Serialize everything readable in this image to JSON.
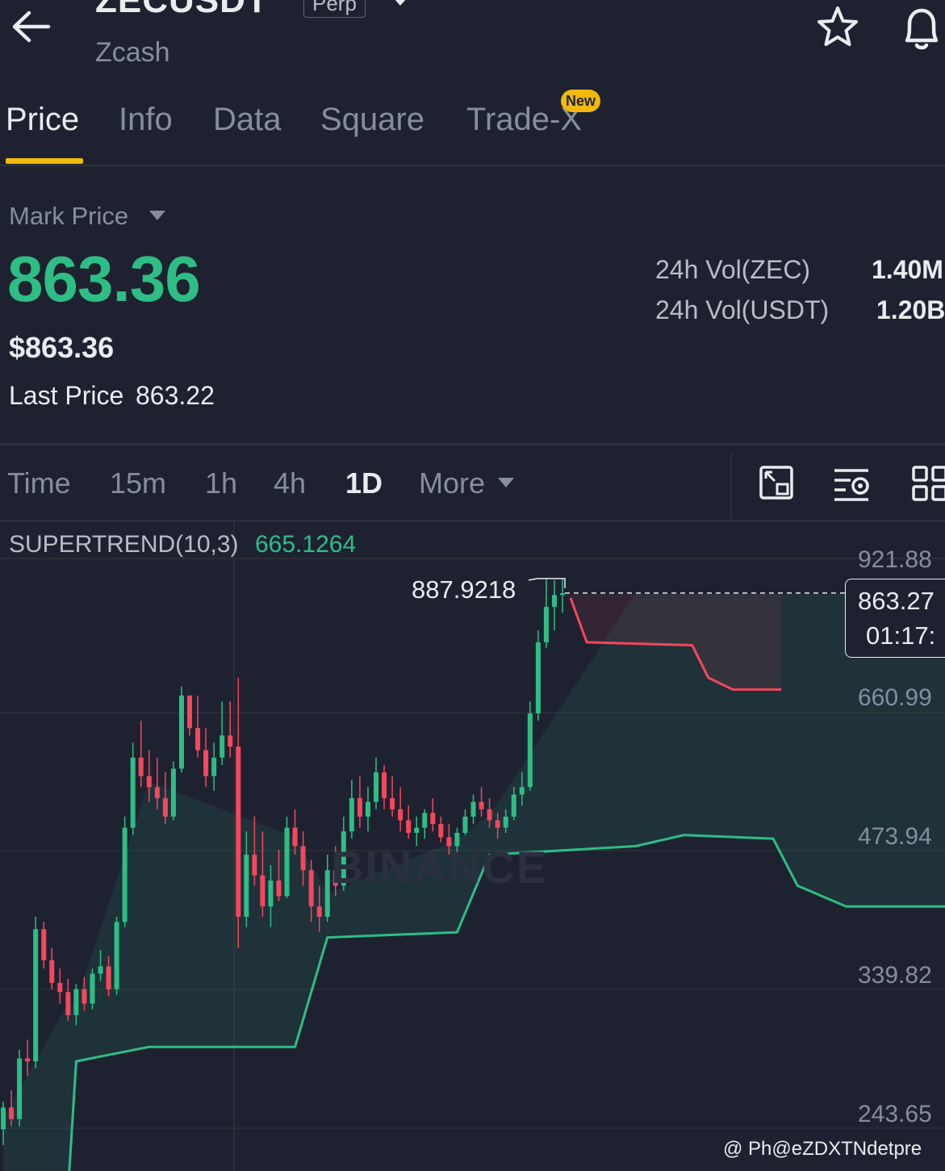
{
  "header": {
    "symbol": "ZECUSDT",
    "contract_badge": "Perp",
    "coin_name": "Zcash",
    "icons": [
      "back-arrow-icon",
      "chevron-down-icon",
      "star-icon",
      "bell-icon"
    ]
  },
  "tabs": [
    {
      "label": "Price",
      "active": true
    },
    {
      "label": "Info"
    },
    {
      "label": "Data"
    },
    {
      "label": "Square"
    },
    {
      "label": "Trade-X",
      "badge": "New"
    }
  ],
  "price_block": {
    "mark_price_label": "Mark Price",
    "mark_price": "863.36",
    "usd_price": "$863.36",
    "last_price_label": "Last Price",
    "last_price": "863.22",
    "stats": [
      {
        "label": "24h Vol(ZEC)",
        "value": "1.40M"
      },
      {
        "label": "24h Vol(USDT)",
        "value": "1.20B"
      }
    ]
  },
  "intervals": {
    "items": [
      "Time",
      "15m",
      "1h",
      "4h",
      "1D",
      "More"
    ],
    "active": "1D",
    "tool_icons": [
      "fullscreen-icon",
      "indicator-settings-icon",
      "grid-layout-icon"
    ]
  },
  "chart": {
    "indicator_label": "SUPERTREND(10,3)",
    "indicator_value": "665.1264",
    "axis_labels": [
      "921.88",
      "660.99",
      "473.94",
      "339.82",
      "243.65"
    ],
    "high_label": "887.9218",
    "current_price_tag": "863.27",
    "countdown": "01:17:",
    "watermark": "BINANCE",
    "credit": "@ Ph@eZDXTNdetpre"
  },
  "colors": {
    "background": "#1e2230",
    "up": "#2ebd85",
    "down": "#f6465d",
    "accent": "#f0b90b",
    "muted_text": "#848e9c"
  },
  "chart_data": {
    "type": "candlestick",
    "title": "",
    "indicator": "SUPERTREND(10,3)",
    "y_ticks": [
      921.88,
      660.99,
      473.94,
      339.82,
      243.65
    ],
    "highest_marked": 887.9218,
    "last_price": 863.27,
    "supertrend_value": 665.1264,
    "supertrend_segments": [
      {
        "trend": "up",
        "points": [
          [
            0,
            200
          ],
          [
            8,
            200
          ],
          [
            9,
            290
          ],
          [
            18,
            300
          ],
          [
            36,
            300
          ],
          [
            40,
            390
          ],
          [
            56,
            395
          ],
          [
            60,
            470
          ],
          [
            78,
            480
          ],
          [
            84,
            495
          ],
          [
            95,
            490
          ],
          [
            98,
            440
          ],
          [
            104,
            420
          ],
          [
            120,
            420
          ],
          [
            130,
            380
          ]
        ]
      },
      {
        "trend": "down",
        "points": [
          [
            70,
            855
          ],
          [
            72,
            780
          ],
          [
            85,
            775
          ],
          [
            87,
            720
          ],
          [
            90,
            700
          ],
          [
            96,
            700
          ]
        ]
      }
    ],
    "candles": [
      [
        243,
        262,
        232,
        258
      ],
      [
        258,
        270,
        245,
        250
      ],
      [
        250,
        298,
        245,
        292
      ],
      [
        292,
        305,
        280,
        290
      ],
      [
        290,
        410,
        285,
        398
      ],
      [
        398,
        405,
        360,
        368
      ],
      [
        368,
        380,
        340,
        346
      ],
      [
        346,
        360,
        330,
        338
      ],
      [
        338,
        350,
        318,
        322
      ],
      [
        322,
        345,
        315,
        340
      ],
      [
        340,
        352,
        325,
        330
      ],
      [
        330,
        360,
        326,
        355
      ],
      [
        355,
        378,
        348,
        362
      ],
      [
        362,
        372,
        335,
        340
      ],
      [
        340,
        410,
        336,
        405
      ],
      [
        405,
        520,
        400,
        505
      ],
      [
        505,
        620,
        495,
        600
      ],
      [
        600,
        650,
        560,
        575
      ],
      [
        575,
        610,
        540,
        560
      ],
      [
        560,
        600,
        530,
        545
      ],
      [
        545,
        580,
        510,
        520
      ],
      [
        520,
        595,
        515,
        585
      ],
      [
        585,
        705,
        580,
        690
      ],
      [
        690,
        690,
        630,
        640
      ],
      [
        640,
        690,
        600,
        610
      ],
      [
        610,
        640,
        560,
        575
      ],
      [
        575,
        620,
        555,
        600
      ],
      [
        600,
        680,
        590,
        630
      ],
      [
        630,
        680,
        600,
        615
      ],
      [
        615,
        720,
        380,
        410
      ],
      [
        410,
        500,
        400,
        470
      ],
      [
        470,
        520,
        440,
        450
      ],
      [
        450,
        500,
        410,
        420
      ],
      [
        420,
        460,
        400,
        445
      ],
      [
        445,
        475,
        425,
        430
      ],
      [
        430,
        520,
        428,
        505
      ],
      [
        505,
        530,
        470,
        480
      ],
      [
        480,
        500,
        440,
        455
      ],
      [
        455,
        465,
        405,
        420
      ],
      [
        420,
        440,
        395,
        410
      ],
      [
        410,
        470,
        405,
        455
      ],
      [
        455,
        480,
        430,
        440
      ],
      [
        440,
        520,
        435,
        500
      ],
      [
        500,
        570,
        490,
        545
      ],
      [
        545,
        575,
        505,
        520
      ],
      [
        520,
        560,
        500,
        540
      ],
      [
        540,
        600,
        530,
        580
      ],
      [
        580,
        590,
        530,
        545
      ],
      [
        545,
        575,
        520,
        530
      ],
      [
        530,
        560,
        500,
        515
      ],
      [
        515,
        535,
        490,
        498
      ],
      [
        498,
        520,
        480,
        505
      ],
      [
        505,
        530,
        490,
        525
      ],
      [
        525,
        545,
        500,
        510
      ],
      [
        510,
        520,
        485,
        492
      ],
      [
        492,
        510,
        470,
        480
      ],
      [
        480,
        505,
        470,
        498
      ],
      [
        498,
        530,
        495,
        520
      ],
      [
        520,
        550,
        510,
        540
      ],
      [
        540,
        560,
        520,
        530
      ],
      [
        530,
        545,
        505,
        515
      ],
      [
        515,
        525,
        490,
        505
      ],
      [
        505,
        530,
        498,
        520
      ],
      [
        520,
        560,
        515,
        550
      ],
      [
        550,
        580,
        535,
        560
      ],
      [
        560,
        680,
        555,
        660
      ],
      [
        660,
        800,
        650,
        780
      ],
      [
        780,
        888,
        770,
        840
      ],
      [
        840,
        885,
        800,
        860
      ],
      [
        860,
        888,
        830,
        863
      ]
    ]
  }
}
